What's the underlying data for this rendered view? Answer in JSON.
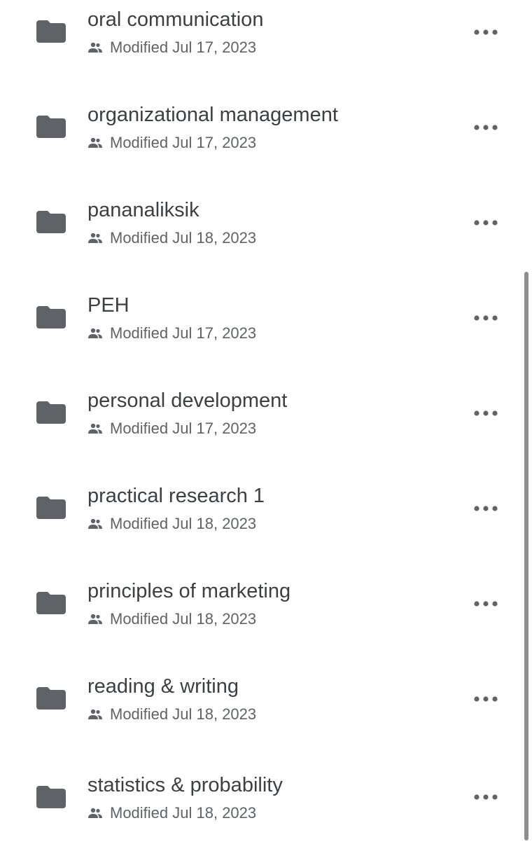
{
  "colors": {
    "folder": "#5f6368",
    "title_text": "#3c4043",
    "meta_text": "#5f6368",
    "scrollbar": "#8e8e8e"
  },
  "icons": {
    "folder": "folder-icon",
    "shared": "shared-people-icon",
    "more": "more-horizontal-icon"
  },
  "files": [
    {
      "name": "oral communication",
      "modified": "Modified Jul 17, 2023"
    },
    {
      "name": "organizational management",
      "modified": "Modified Jul 17, 2023"
    },
    {
      "name": "pananaliksik",
      "modified": "Modified Jul 18, 2023"
    },
    {
      "name": "PEH",
      "modified": "Modified Jul 17, 2023"
    },
    {
      "name": "personal development",
      "modified": "Modified Jul 17, 2023"
    },
    {
      "name": "practical research 1",
      "modified": "Modified Jul 18, 2023"
    },
    {
      "name": "principles of marketing",
      "modified": "Modified Jul 18, 2023"
    },
    {
      "name": "reading & writing",
      "modified": "Modified Jul 18, 2023"
    },
    {
      "name": "statistics & probability",
      "modified": "Modified Jul 18, 2023"
    }
  ]
}
